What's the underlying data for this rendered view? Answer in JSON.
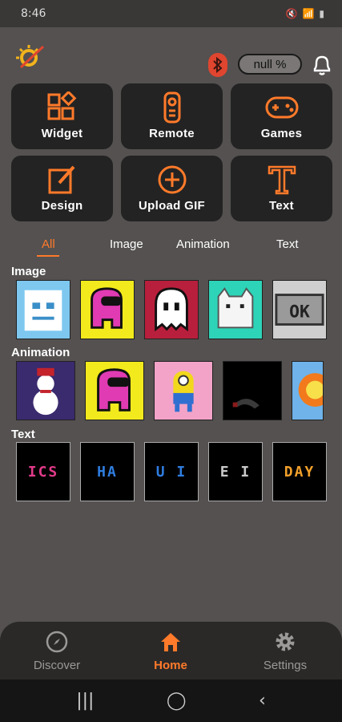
{
  "status_bar": {
    "time": "8:46"
  },
  "header": {
    "battery_text": "null %"
  },
  "tiles": [
    {
      "label": "Widget",
      "icon": "widget-icon"
    },
    {
      "label": "Remote",
      "icon": "remote-icon"
    },
    {
      "label": "Games",
      "icon": "gamepad-icon"
    },
    {
      "label": "Design",
      "icon": "edit-icon"
    },
    {
      "label": "Upload GIF",
      "icon": "plus-circle-icon"
    },
    {
      "label": "Text",
      "icon": "text-T-icon"
    }
  ],
  "filter_tabs": [
    "All",
    "Image",
    "Animation",
    "Text"
  ],
  "active_filter": "All",
  "sections": {
    "image": "Image",
    "animation": "Animation",
    "text": "Text"
  },
  "text_thumbs": [
    {
      "text": "ICS",
      "color": "#e23a8a"
    },
    {
      "text": "HA",
      "color": "#2f7de0"
    },
    {
      "text": "U I",
      "color": "#2f7de0"
    },
    {
      "text": "E I",
      "color": "#c9c9c9"
    },
    {
      "text": "DAY",
      "color": "#f2a02b"
    }
  ],
  "bottom_nav": [
    {
      "label": "Discover",
      "icon": "compass-icon"
    },
    {
      "label": "Home",
      "icon": "home-icon"
    },
    {
      "label": "Settings",
      "icon": "gear-icon"
    }
  ],
  "colors": {
    "accent": "#ff7a2a",
    "tile_bg": "#232323",
    "page_bg": "#545150"
  }
}
